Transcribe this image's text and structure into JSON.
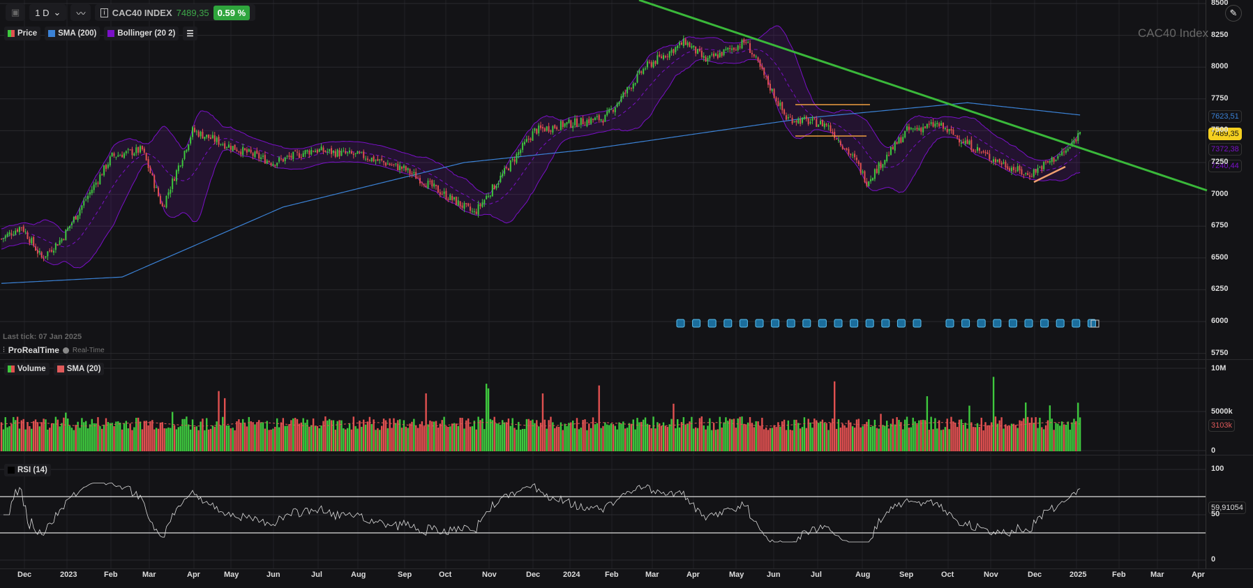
{
  "toolbar": {
    "timeframe": "1 D",
    "symbol": "CAC40 INDEX",
    "last_price": "7489,35",
    "change": "0.59 %"
  },
  "legend_price": {
    "items": [
      {
        "label": "Price",
        "color": "#e05050"
      },
      {
        "label": "SMA (200)",
        "color": "#3b82d6"
      },
      {
        "label": "Bollinger (20 2)",
        "color": "#7a10c8"
      }
    ]
  },
  "legend_volume": {
    "items": [
      {
        "label": "Volume",
        "color": "#3ec83e"
      },
      {
        "label": "SMA (20)",
        "color": "#e05a5a"
      }
    ]
  },
  "legend_rsi": {
    "label": "RSI (14)"
  },
  "watermark": "CAC40 Index",
  "last_tick": "Last tick: 07 Jan 2025",
  "provider": "ProRealTime",
  "realtime": "Real-Time",
  "price_tags": {
    "sma": "7623,51",
    "last": "7489,35",
    "boll_mid": "7372,38",
    "boll_low": "7240,44"
  },
  "volume_tag": "3103k",
  "rsi_tag": "59,91054",
  "chart_data": {
    "type": "candlestick",
    "price_axis": {
      "ticks": [
        8500,
        8250,
        8000,
        7750,
        7500,
        7250,
        7000,
        6750,
        6500,
        6250,
        6000,
        5750
      ],
      "range": [
        5750,
        8500
      ]
    },
    "volume_axis": {
      "labels": [
        "10M",
        "5000k",
        "0"
      ],
      "range": [
        0,
        10000000
      ]
    },
    "rsi_axis": {
      "ticks": [
        100,
        50,
        0
      ],
      "levels": [
        70,
        30
      ]
    },
    "x_labels": [
      "Dec",
      "2023",
      "Feb",
      "Mar",
      "Apr",
      "May",
      "Jun",
      "Jul",
      "Aug",
      "Sep",
      "Oct",
      "Nov",
      "Dec",
      "2024",
      "Feb",
      "Mar",
      "Apr",
      "May",
      "Jun",
      "Jul",
      "Aug",
      "Sep",
      "Oct",
      "Nov",
      "Dec",
      "2025",
      "Feb",
      "Mar",
      "Apr"
    ],
    "close_path": [
      [
        0,
        6650
      ],
      [
        10,
        6750
      ],
      [
        20,
        6500
      ],
      [
        30,
        6650
      ],
      [
        55,
        7300
      ],
      [
        70,
        7350
      ],
      [
        80,
        6900
      ],
      [
        95,
        7500
      ],
      [
        110,
        7400
      ],
      [
        135,
        7250
      ],
      [
        155,
        7350
      ],
      [
        180,
        7300
      ],
      [
        200,
        7200
      ],
      [
        225,
        6950
      ],
      [
        235,
        6850
      ],
      [
        265,
        7500
      ],
      [
        280,
        7550
      ],
      [
        300,
        7600
      ],
      [
        320,
        8000
      ],
      [
        340,
        8200
      ],
      [
        350,
        8050
      ],
      [
        370,
        8200
      ],
      [
        390,
        7600
      ],
      [
        410,
        7550
      ],
      [
        425,
        7250
      ],
      [
        430,
        7100
      ],
      [
        450,
        7500
      ],
      [
        465,
        7550
      ],
      [
        490,
        7300
      ],
      [
        510,
        7150
      ],
      [
        530,
        7350
      ],
      [
        536,
        7489.35
      ]
    ],
    "sma200_path": [
      [
        0,
        6300
      ],
      [
        60,
        6350
      ],
      [
        140,
        6900
      ],
      [
        230,
        7250
      ],
      [
        290,
        7350
      ],
      [
        400,
        7600
      ],
      [
        480,
        7720
      ],
      [
        536,
        7623.51
      ]
    ],
    "trendline": [
      [
        8550,
        "2024-03"
      ],
      [
        7030,
        "2025-04"
      ]
    ]
  }
}
